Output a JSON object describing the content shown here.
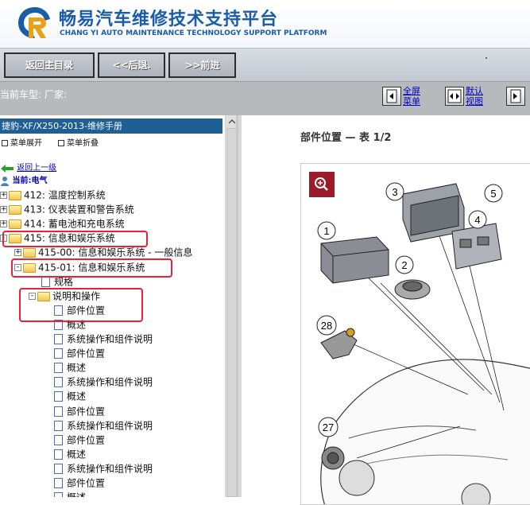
{
  "header": {
    "title_cn": "畅易汽车维修技术支持平台",
    "title_en": "CHANG YI AUTO MAINTENANCE TECHNOLOGY SUPPORT PLATFORM",
    "logo_icon": "logo-icon"
  },
  "nav": {
    "home_label": "返回主目录",
    "back_label": "<<后退.",
    "forward_label": ">>前进"
  },
  "info": {
    "car_model_label": "当前车型:  厂家:",
    "fullscreen_label_1": "全屏",
    "fullscreen_label_2": "菜单",
    "default_view_label_1": "默认",
    "default_view_label_2": "视图"
  },
  "left": {
    "doc_title": "捷豹-XF/X250-2013-维修手册",
    "expand_label": "菜单展开",
    "collapse_label": "菜单折叠",
    "back_up_label": "返回上一级",
    "current_label": "当前:电气",
    "tree": [
      {
        "label": "412: 温度控制系统",
        "type": "folder",
        "indent": 0,
        "expander": "+"
      },
      {
        "label": "413: 仪表装置和警告系统",
        "type": "folder",
        "indent": 0,
        "expander": "+"
      },
      {
        "label": "414: 蓄电池和充电系统",
        "type": "folder",
        "indent": 0,
        "expander": "+"
      },
      {
        "label": "415: 信息和娱乐系统",
        "type": "folder",
        "indent": 0,
        "expander": "-"
      },
      {
        "label": "415-00: 信息和娱乐系统 - 一般信息",
        "type": "folder",
        "indent": 1,
        "expander": "+"
      },
      {
        "label": "415-01: 信息和娱乐系统",
        "type": "folder",
        "indent": 1,
        "expander": "-"
      },
      {
        "label": "规格",
        "type": "page",
        "indent": 2
      },
      {
        "label": "说明和操作",
        "type": "folder",
        "indent": 2,
        "expander": "-"
      },
      {
        "label": "部件位置",
        "type": "page",
        "indent": 3
      },
      {
        "label": "概述",
        "type": "page",
        "indent": 3
      },
      {
        "label": "系统操作和组件说明",
        "type": "page",
        "indent": 3
      },
      {
        "label": "部件位置",
        "type": "page",
        "indent": 3
      },
      {
        "label": "概述",
        "type": "page",
        "indent": 3
      },
      {
        "label": "系统操作和组件说明",
        "type": "page",
        "indent": 3
      },
      {
        "label": "概述",
        "type": "page",
        "indent": 3
      },
      {
        "label": "部件位置",
        "type": "page",
        "indent": 3
      },
      {
        "label": "系统操作和组件说明",
        "type": "page",
        "indent": 3
      },
      {
        "label": "部件位置",
        "type": "page",
        "indent": 3
      },
      {
        "label": "概述",
        "type": "page",
        "indent": 3
      },
      {
        "label": "系统操作和组件说明",
        "type": "page",
        "indent": 3
      },
      {
        "label": "部件位置",
        "type": "page",
        "indent": 3
      },
      {
        "label": "概述",
        "type": "page",
        "indent": 3
      }
    ]
  },
  "content": {
    "heading": "部件位置 — 表 1/2",
    "callouts": [
      "1",
      "2",
      "3",
      "4",
      "5",
      "28",
      "27"
    ]
  },
  "colors": {
    "brand_blue": "#1a5ca8",
    "doc_title_bg": "#1f5f96",
    "highlight_red": "#e8223a",
    "zoom_button": "#9a1b2a"
  }
}
